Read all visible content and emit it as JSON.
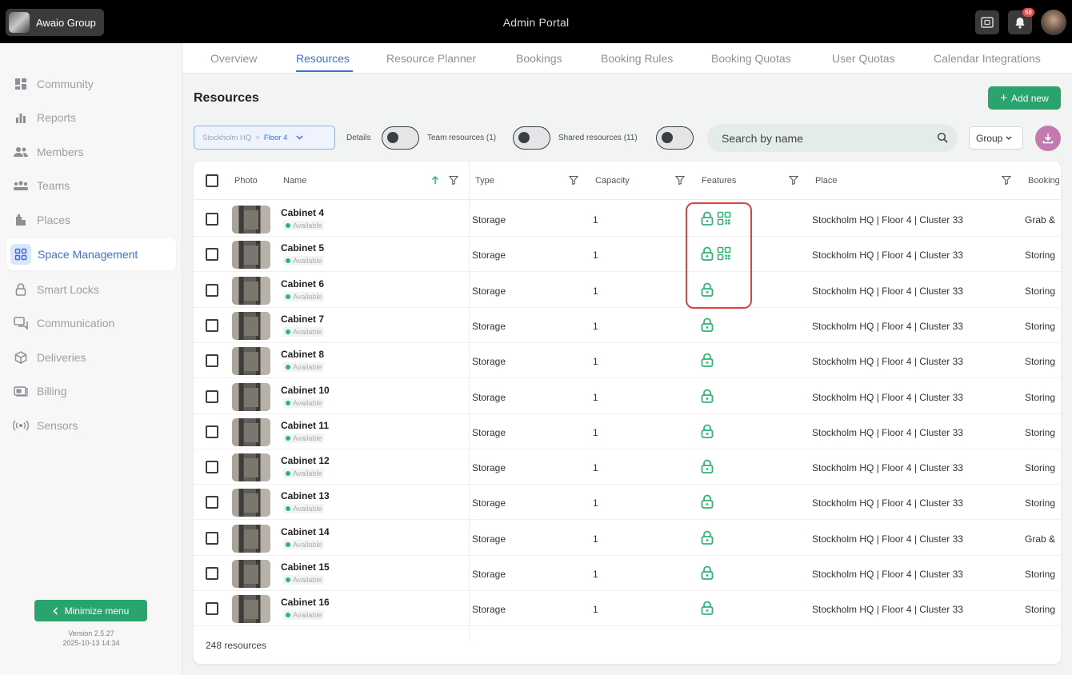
{
  "topbar": {
    "org_name": "Awaio Group",
    "app_title": "Admin Portal",
    "notification_count": "68"
  },
  "sidebar": {
    "items": [
      {
        "label": "Community",
        "icon": "dashboard-icon"
      },
      {
        "label": "Reports",
        "icon": "bar-chart-icon"
      },
      {
        "label": "Members",
        "icon": "members-icon"
      },
      {
        "label": "Teams",
        "icon": "teams-icon"
      },
      {
        "label": "Places",
        "icon": "building-icon"
      },
      {
        "label": "Space Management",
        "icon": "space-grid-icon",
        "active": true
      },
      {
        "label": "Smart Locks",
        "icon": "lock-icon"
      },
      {
        "label": "Communication",
        "icon": "chat-icon"
      },
      {
        "label": "Deliveries",
        "icon": "package-icon"
      },
      {
        "label": "Billing",
        "icon": "billing-icon"
      },
      {
        "label": "Sensors",
        "icon": "sensor-icon"
      }
    ],
    "minimize_label": "Minimize menu",
    "version": "Version 2.5.27",
    "build_date": "2025-10-13 14:34"
  },
  "tabs": [
    "Overview",
    "Resources",
    "Resource Planner",
    "Bookings",
    "Booking Rules",
    "Booking Quotas",
    "User Quotas",
    "Calendar Integrations"
  ],
  "active_tab": "Resources",
  "page": {
    "title": "Resources",
    "add_label": "Add new"
  },
  "filters": {
    "place_segment_1": "Stockholm HQ",
    "place_separator": ">",
    "place_segment_2": "Floor 4",
    "details_label": "Details",
    "team_label": "Team resources (1)",
    "shared_label": "Shared resources (11)",
    "search_placeholder": "Search by name",
    "group_label": "Group"
  },
  "table": {
    "columns": [
      "Photo",
      "Name",
      "Type",
      "Capacity",
      "Features",
      "Place",
      "Booking"
    ],
    "rows": [
      {
        "name": "Cabinet 4",
        "status": "Available",
        "type": "Storage",
        "capacity": "1",
        "features": [
          "lock",
          "qr"
        ],
        "place": "Stockholm HQ | Floor 4 | Cluster 33",
        "booking": "Grab &"
      },
      {
        "name": "Cabinet 5",
        "status": "Available",
        "type": "Storage",
        "capacity": "1",
        "features": [
          "lock",
          "qr"
        ],
        "place": "Stockholm HQ | Floor 4 | Cluster 33",
        "booking": "Storing"
      },
      {
        "name": "Cabinet 6",
        "status": "Available",
        "type": "Storage",
        "capacity": "1",
        "features": [
          "lock"
        ],
        "place": "Stockholm HQ | Floor 4 | Cluster 33",
        "booking": "Storing"
      },
      {
        "name": "Cabinet 7",
        "status": "Available",
        "type": "Storage",
        "capacity": "1",
        "features": [
          "lock"
        ],
        "place": "Stockholm HQ | Floor 4 | Cluster 33",
        "booking": "Storing"
      },
      {
        "name": "Cabinet 8",
        "status": "Available",
        "type": "Storage",
        "capacity": "1",
        "features": [
          "lock"
        ],
        "place": "Stockholm HQ | Floor 4 | Cluster 33",
        "booking": "Storing"
      },
      {
        "name": "Cabinet 10",
        "status": "Available",
        "type": "Storage",
        "capacity": "1",
        "features": [
          "lock"
        ],
        "place": "Stockholm HQ | Floor 4 | Cluster 33",
        "booking": "Storing"
      },
      {
        "name": "Cabinet 11",
        "status": "Available",
        "type": "Storage",
        "capacity": "1",
        "features": [
          "lock"
        ],
        "place": "Stockholm HQ | Floor 4 | Cluster 33",
        "booking": "Storing"
      },
      {
        "name": "Cabinet 12",
        "status": "Available",
        "type": "Storage",
        "capacity": "1",
        "features": [
          "lock"
        ],
        "place": "Stockholm HQ | Floor 4 | Cluster 33",
        "booking": "Storing"
      },
      {
        "name": "Cabinet 13",
        "status": "Available",
        "type": "Storage",
        "capacity": "1",
        "features": [
          "lock"
        ],
        "place": "Stockholm HQ | Floor 4 | Cluster 33",
        "booking": "Storing"
      },
      {
        "name": "Cabinet 14",
        "status": "Available",
        "type": "Storage",
        "capacity": "1",
        "features": [
          "lock"
        ],
        "place": "Stockholm HQ | Floor 4 | Cluster 33",
        "booking": "Grab &"
      },
      {
        "name": "Cabinet 15",
        "status": "Available",
        "type": "Storage",
        "capacity": "1",
        "features": [
          "lock"
        ],
        "place": "Stockholm HQ | Floor 4 | Cluster 33",
        "booking": "Storing"
      },
      {
        "name": "Cabinet 16",
        "status": "Available",
        "type": "Storage",
        "capacity": "1",
        "features": [
          "lock"
        ],
        "place": "Stockholm HQ | Floor 4 | Cluster 33",
        "booking": "Storing"
      }
    ],
    "count_label": "248 resources"
  },
  "colors": {
    "accent": "#3b6fe0",
    "primary_green": "#28a46c",
    "feature_green": "#2bb673",
    "highlight_red": "#e0433b"
  }
}
